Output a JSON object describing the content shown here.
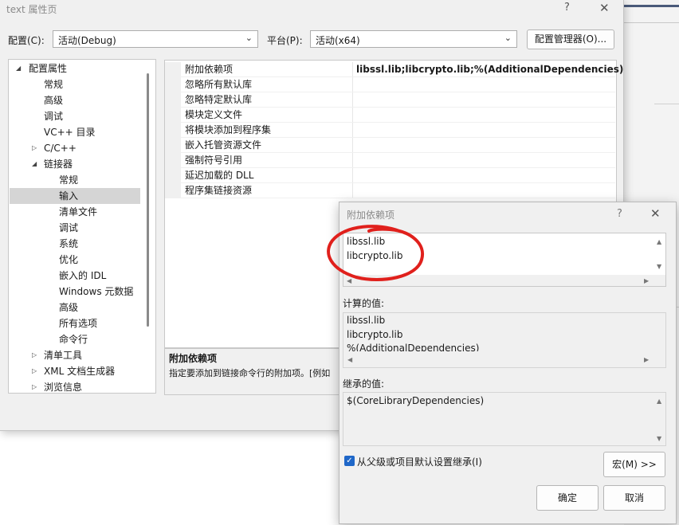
{
  "main_dialog": {
    "title": "text 属性页",
    "help_glyph": "?",
    "close_glyph": "✕",
    "config_label": "配置(C):",
    "config_value": "活动(Debug)",
    "platform_label": "平台(P):",
    "platform_value": "活动(x64)",
    "config_manager_button": "配置管理器(O)..."
  },
  "tree": {
    "items": [
      {
        "label": "配置属性",
        "arrow": "◢"
      },
      {
        "label": "常规"
      },
      {
        "label": "高级"
      },
      {
        "label": "调试"
      },
      {
        "label": "VC++ 目录"
      },
      {
        "label": "C/C++",
        "arrow": "▷"
      },
      {
        "label": "链接器",
        "arrow": "◢"
      },
      {
        "label": "常规"
      },
      {
        "label": "输入",
        "selected": true
      },
      {
        "label": "清单文件"
      },
      {
        "label": "调试"
      },
      {
        "label": "系统"
      },
      {
        "label": "优化"
      },
      {
        "label": "嵌入的 IDL"
      },
      {
        "label": "Windows 元数据"
      },
      {
        "label": "高级"
      },
      {
        "label": "所有选项"
      },
      {
        "label": "命令行"
      },
      {
        "label": "清单工具",
        "arrow": "▷"
      },
      {
        "label": "XML 文档生成器",
        "arrow": "▷"
      },
      {
        "label": "浏览信息",
        "arrow": "▷"
      }
    ]
  },
  "property_grid": {
    "rows": [
      {
        "name": "附加依赖项",
        "value": "libssl.lib;libcrypto.lib;%(AdditionalDependencies)"
      },
      {
        "name": "忽略所有默认库",
        "value": ""
      },
      {
        "name": "忽略特定默认库",
        "value": ""
      },
      {
        "name": "模块定义文件",
        "value": ""
      },
      {
        "name": "将模块添加到程序集",
        "value": ""
      },
      {
        "name": "嵌入托管资源文件",
        "value": ""
      },
      {
        "name": "强制符号引用",
        "value": ""
      },
      {
        "name": "延迟加载的 DLL",
        "value": ""
      },
      {
        "name": "程序集链接资源",
        "value": ""
      }
    ]
  },
  "description": {
    "title": "附加依赖项",
    "text": "指定要添加到链接命令行的附加项。[例如"
  },
  "dep_dialog": {
    "title": "附加依赖项",
    "help_glyph": "?",
    "close_glyph": "✕",
    "edit_lines": [
      "libssl.lib",
      "libcrypto.lib"
    ],
    "computed_label": "计算的值:",
    "computed_lines": [
      "libssl.lib",
      "libcrypto.lib",
      "%(AdditionalDependencies)"
    ],
    "inherited_label": "继承的值:",
    "inherited_lines": [
      "$(CoreLibraryDependencies)"
    ],
    "inherit_checkbox_label": "从父级或项目默认设置继承(I)",
    "inherit_checked": true,
    "macros_button": "宏(M) >>",
    "ok_button": "确定",
    "cancel_button": "取消"
  },
  "colors": {
    "annotation_circle": "#e0201c",
    "checkbox_accent": "#1f67c8",
    "tree_selection": "#d5d5d5",
    "dialog_background": "#f0f0f0"
  }
}
